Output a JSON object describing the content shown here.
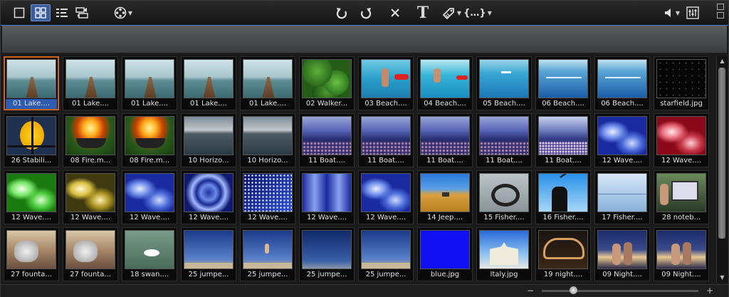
{
  "toolbar": {
    "left_buttons": [
      "single-view-icon",
      "grid-view-icon",
      "list-view-icon",
      "video-audio-icon",
      "film-reel-icon"
    ],
    "center_buttons": [
      "undo-icon",
      "redo-icon",
      "delete-icon",
      "text-icon",
      "tag-icon",
      "bracket-icon"
    ],
    "text_button_glyph": "T",
    "bracket_glyph": "{…}",
    "right_buttons": [
      "volume-icon",
      "mixer-icon"
    ]
  },
  "thumbnails": [
    {
      "label": "01 Lake....",
      "kind": "pier",
      "selected": true
    },
    {
      "label": "01 Lake....",
      "kind": "pier"
    },
    {
      "label": "01 Lake....",
      "kind": "pier"
    },
    {
      "label": "01 Lake....",
      "kind": "pier"
    },
    {
      "label": "01 Lake....",
      "kind": "pier"
    },
    {
      "label": "02 Walker...",
      "kind": "leaves"
    },
    {
      "label": "03 Beach....",
      "kind": "beach1"
    },
    {
      "label": "04 Beach....",
      "kind": "beach2"
    },
    {
      "label": "05 Beach....",
      "kind": "beach3"
    },
    {
      "label": "06 Beach....",
      "kind": "beach4"
    },
    {
      "label": "06 Beach....",
      "kind": "beach4"
    },
    {
      "label": "starfield.jpg",
      "kind": "stars"
    },
    {
      "label": "26 Stabili...",
      "kind": "yellow"
    },
    {
      "label": "08 Fire.m...",
      "kind": "fire"
    },
    {
      "label": "08 Fire.m...",
      "kind": "fire"
    },
    {
      "label": "10 Horizo...",
      "kind": "horizon"
    },
    {
      "label": "10 Horizo...",
      "kind": "horizon"
    },
    {
      "label": "11 Boat....",
      "kind": "boat"
    },
    {
      "label": "11 Boat....",
      "kind": "boat"
    },
    {
      "label": "11 Boat....",
      "kind": "boat"
    },
    {
      "label": "11 Boat....",
      "kind": "boat"
    },
    {
      "label": "11 Boat....",
      "kind": "boat2"
    },
    {
      "label": "12 Wave....",
      "kind": "wave-blue"
    },
    {
      "label": "12 Wave....",
      "kind": "wave-red"
    },
    {
      "label": "12 Wave....",
      "kind": "wave-green"
    },
    {
      "label": "12 Wave....",
      "kind": "wave-yellow"
    },
    {
      "label": "12 Wave....",
      "kind": "wave-blue"
    },
    {
      "label": "12 Wave....",
      "kind": "wave-swirl"
    },
    {
      "label": "12 Wave....",
      "kind": "wave-dots"
    },
    {
      "label": "12 Wave....",
      "kind": "wave-mirror"
    },
    {
      "label": "12 Wave....",
      "kind": "wave-blue"
    },
    {
      "label": "14 Jeep....",
      "kind": "jeep"
    },
    {
      "label": "15 Fisher....",
      "kind": "fisher1"
    },
    {
      "label": "16 Fisher....",
      "kind": "fisher2"
    },
    {
      "label": "17 Fisher....",
      "kind": "fisher3"
    },
    {
      "label": "28 noteb...",
      "kind": "notebook"
    },
    {
      "label": "27 founta...",
      "kind": "fountain"
    },
    {
      "label": "27 founta...",
      "kind": "fountain"
    },
    {
      "label": "18 swan....",
      "kind": "swan"
    },
    {
      "label": "25 jumpe...",
      "kind": "jump1"
    },
    {
      "label": "25 jumpe...",
      "kind": "jump2"
    },
    {
      "label": "25 jumpe...",
      "kind": "jump3"
    },
    {
      "label": "25 jumpe...",
      "kind": "jump1"
    },
    {
      "label": "blue.jpg",
      "kind": "blue"
    },
    {
      "label": "Italy.jpg",
      "kind": "italy"
    },
    {
      "label": "19 night....",
      "kind": "night"
    },
    {
      "label": "09 Night....",
      "kind": "couple"
    },
    {
      "label": "09 Night....",
      "kind": "couple"
    }
  ],
  "zoom": {
    "minus": "−",
    "plus": "+",
    "level": 0.2
  },
  "colors": {
    "accent": "#4a78c8",
    "selection": "#c8641e",
    "label_highlight": "#2f5bb0"
  }
}
